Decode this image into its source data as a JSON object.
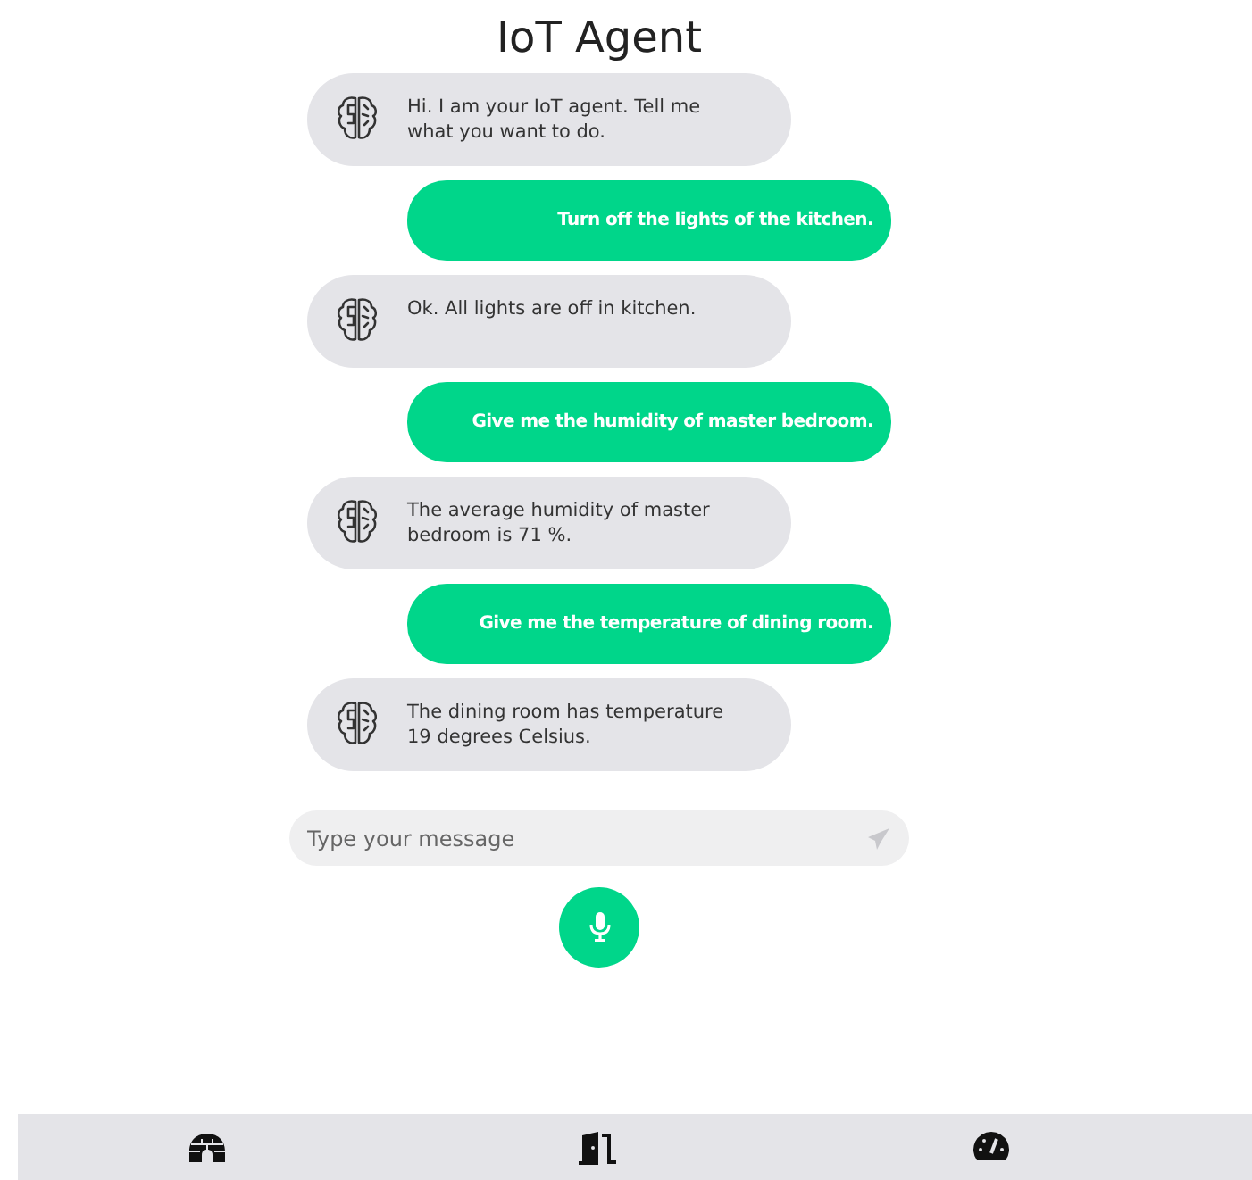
{
  "title": "IoT Agent",
  "messages": [
    {
      "kind": "bot",
      "text": "Hi. I am your IoT agent. Tell me what you want to do."
    },
    {
      "kind": "user",
      "text": "Turn off the lights of the kitchen."
    },
    {
      "kind": "bot",
      "text": "Ok. All lights are off in kitchen."
    },
    {
      "kind": "user",
      "text": "Give me the humidity of master bedroom."
    },
    {
      "kind": "bot",
      "text": "The average humidity of master bedroom is 71 %."
    },
    {
      "kind": "user",
      "text": "Give me the temperature of dining room."
    },
    {
      "kind": "bot",
      "text": "The dining room has temperature 19 degrees Celsius."
    }
  ],
  "input": {
    "placeholder": "Type your message"
  }
}
